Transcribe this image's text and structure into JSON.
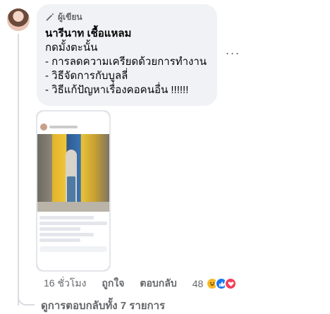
{
  "comment": {
    "author_badge": "ผู้เขียน",
    "author_name": "นารีนาท เชื้อแหลม",
    "lines": [
      "กดมั้งตะนั้น",
      "- การลดความเครียดด้วยการทำงาน",
      "- วิธีจัดการกับบูลลี่",
      "- วิธีแก้ปัญหาเรื่องคอคนอื่น !!!!!!"
    ],
    "more_label": "···"
  },
  "actions": {
    "time": "16 ชั่วโมง",
    "like": "ถูกใจ",
    "reply": "ตอบกลับ",
    "reaction_count": "48"
  },
  "view_replies": "ดูการตอบกลับทั้ง 7 รายการ",
  "colors": {
    "bubble": "#f0f2f5",
    "muted_text": "#65676b",
    "like_blue": "#1877f2",
    "love_red": "#f33e58",
    "haha_yellow": "#f7b928"
  }
}
